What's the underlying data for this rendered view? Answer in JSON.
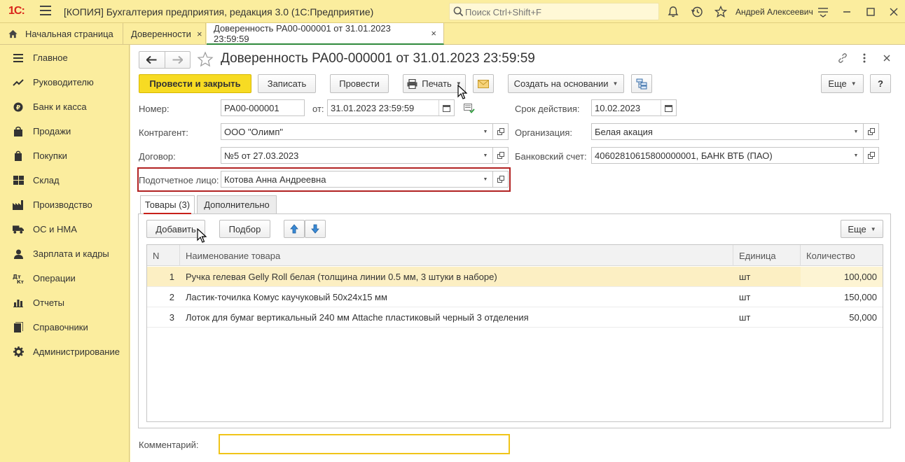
{
  "app": {
    "logo": "1С:",
    "title": "[КОПИЯ] Бухгалтерия предприятия, редакция 3.0  (1С:Предприятие)",
    "search_placeholder": "Поиск Ctrl+Shift+F",
    "user": "Андрей Алексеевич"
  },
  "tabs": [
    {
      "label": "Начальная страница"
    },
    {
      "label": "Доверенности",
      "close": "×"
    },
    {
      "label": "Доверенность РА00-000001 от 31.01.2023 23:59:59",
      "close": "×"
    }
  ],
  "sidebar": {
    "items": [
      {
        "label": "Главное",
        "icon": "menu-icon"
      },
      {
        "label": "Руководителю",
        "icon": "chart-trend-icon"
      },
      {
        "label": "Банк и касса",
        "icon": "coin-icon"
      },
      {
        "label": "Продажи",
        "icon": "shopping-bag-icon"
      },
      {
        "label": "Покупки",
        "icon": "cart-icon"
      },
      {
        "label": "Склад",
        "icon": "warehouse-icon"
      },
      {
        "label": "Производство",
        "icon": "factory-icon"
      },
      {
        "label": "ОС и НМА",
        "icon": "truck-icon"
      },
      {
        "label": "Зарплата и кадры",
        "icon": "person-icon"
      },
      {
        "label": "Операции",
        "icon": "debit-credit-icon"
      },
      {
        "label": "Отчеты",
        "icon": "bar-chart-icon"
      },
      {
        "label": "Справочники",
        "icon": "book-icon"
      },
      {
        "label": "Администрирование",
        "icon": "gear-icon"
      }
    ]
  },
  "document": {
    "title": "Доверенность РА00-000001 от 31.01.2023 23:59:59"
  },
  "toolbar": {
    "post_close": "Провести и закрыть",
    "save": "Записать",
    "post": "Провести",
    "print": "Печать",
    "create_based": "Создать на основании",
    "more": "Еще",
    "help": "?"
  },
  "form": {
    "number_label": "Номер:",
    "number": "РА00-000001",
    "date_label": "от:",
    "date": "31.01.2023 23:59:59",
    "valid_label": "Срок действия:",
    "valid": "10.02.2023",
    "counterparty_label": "Контрагент:",
    "counterparty": "ООО \"Олимп\"",
    "org_label": "Организация:",
    "org": "Белая акация",
    "contract_label": "Договор:",
    "contract": "№5 от 27.03.2023",
    "bank_label": "Банковский счет:",
    "bank": "40602810615800000001, БАНК ВТБ (ПАО)",
    "person_label": "Подотчетное лицо:",
    "person": "Котова Анна Андреевна",
    "comment_label": "Комментарий:",
    "comment": ""
  },
  "inner_tabs": [
    {
      "label": "Товары (3)"
    },
    {
      "label": "Дополнительно"
    }
  ],
  "table_toolbar": {
    "add": "Добавить",
    "select": "Подбор",
    "more": "Еще"
  },
  "table": {
    "columns": [
      "N",
      "Наименование товара",
      "Единица",
      "Количество"
    ],
    "rows": [
      {
        "n": "1",
        "name": "Ручка гелевая Gelly Roll белая (толщина линии 0.5 мм, 3 штуки в наборе)",
        "unit": "шт",
        "qty": "100,000"
      },
      {
        "n": "2",
        "name": "Ластик-точилка Комус каучуковый 50х24х15 мм",
        "unit": "шт",
        "qty": "150,000"
      },
      {
        "n": "3",
        "name": "Лоток для бумаг вертикальный 240 мм Attache пластиковый черный 3 отделения",
        "unit": "шт",
        "qty": "50,000"
      }
    ]
  },
  "colors": {
    "shell": "#fbed9e",
    "primary_button": "#f7db23",
    "selected_row": "#fcefc3",
    "highlight_border": "#b22222",
    "tab_underline": "#c8201a",
    "active_tab_underline": "#2f8a3c"
  }
}
